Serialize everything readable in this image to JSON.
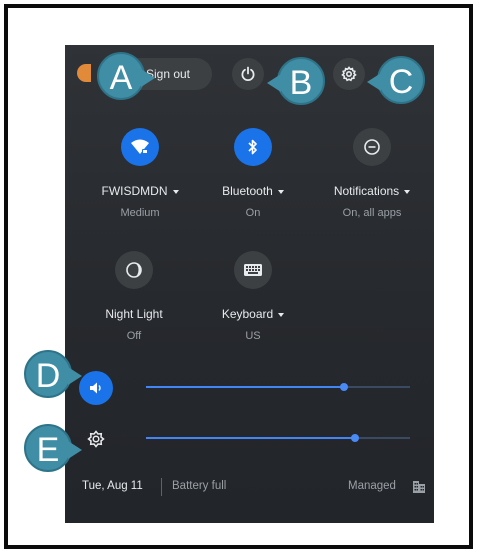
{
  "header": {
    "sign_out_label": "Sign out",
    "power_icon": "power-icon",
    "settings_icon": "gear-icon"
  },
  "callouts": [
    "A",
    "B",
    "C",
    "D",
    "E"
  ],
  "tiles": [
    {
      "label": "FWISDMDN",
      "sub": "Medium",
      "icon": "wifi-icon",
      "active": true,
      "has_menu": true
    },
    {
      "label": "Bluetooth",
      "sub": "On",
      "icon": "bluetooth-icon",
      "active": true,
      "has_menu": true
    },
    {
      "label": "Notifications",
      "sub": "On, all apps",
      "icon": "do-not-disturb-icon",
      "active": false,
      "has_menu": true
    },
    {
      "label": "Night Light",
      "sub": "Off",
      "icon": "night-light-icon",
      "active": false,
      "has_menu": false
    },
    {
      "label": "Keyboard",
      "sub": "US",
      "icon": "keyboard-icon",
      "active": false,
      "has_menu": true
    }
  ],
  "sliders": {
    "volume_level": 0.75,
    "brightness_level": 0.79
  },
  "footer": {
    "date": "Tue, Aug 11",
    "battery": "Battery full",
    "managed": "Managed"
  },
  "colors": {
    "accent": "#1a73e8",
    "panel": "#2b2e33",
    "callout": "#3f8ea6"
  }
}
